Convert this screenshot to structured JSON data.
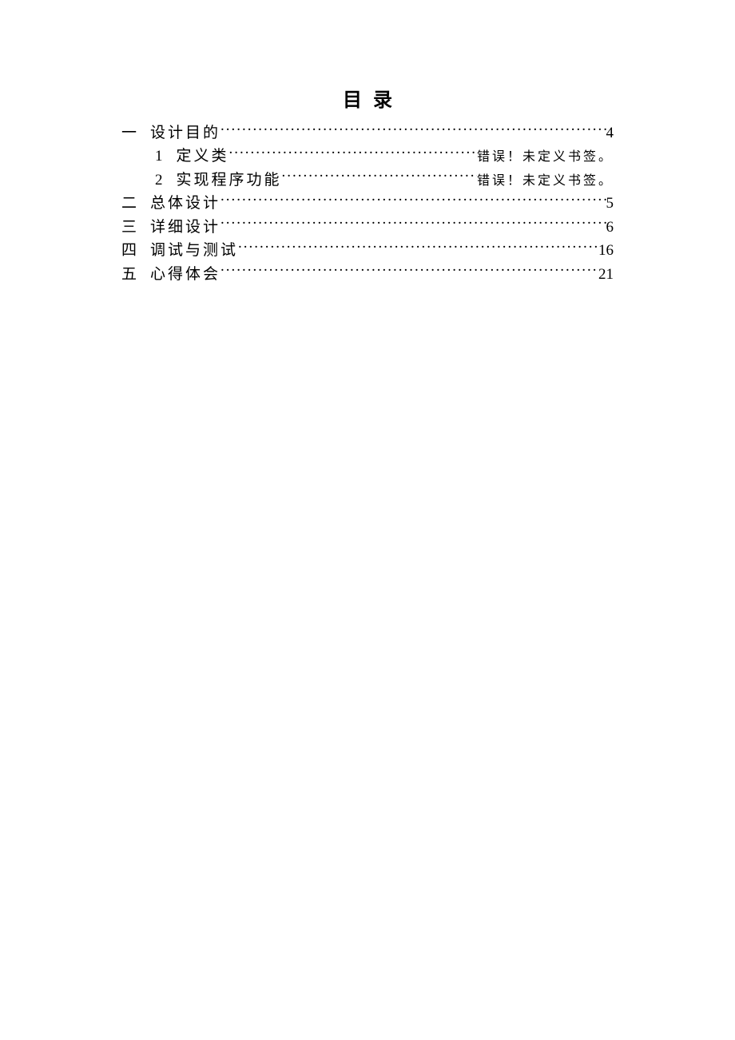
{
  "title": "目录",
  "toc": [
    {
      "level": 1,
      "num": "一",
      "label": "设计目的",
      "page": "4",
      "error": false
    },
    {
      "level": 2,
      "num": "1",
      "label": "定义类",
      "page": "错误！未定义书签。",
      "error": true
    },
    {
      "level": 2,
      "num": "2",
      "label": "实现程序功能",
      "page": "错误！未定义书签。",
      "error": true
    },
    {
      "level": 1,
      "num": "二",
      "label": "总体设计",
      "page": "5",
      "error": false
    },
    {
      "level": 1,
      "num": "三",
      "label": "详细设计",
      "page": "6",
      "error": false
    },
    {
      "level": 1,
      "num": "四",
      "label": "调试与测试",
      "page": "16",
      "error": false
    },
    {
      "level": 1,
      "num": "五",
      "label": "心得体会",
      "page": "21",
      "error": false
    }
  ]
}
